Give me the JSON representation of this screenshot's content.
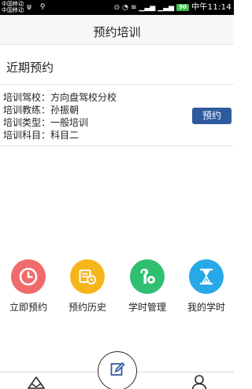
{
  "status_bar": {
    "carrier1": "中国移动",
    "carrier2": "中国移动",
    "battery": "90",
    "time": "中午11:14",
    "left_icons": "ψ ⚲"
  },
  "header": {
    "title": "预约培训"
  },
  "recent": {
    "title": "近期预约",
    "booking": {
      "school": "培训驾校：方向盘驾校分校",
      "coach": "培训教练：孙振朝",
      "type": "培训类型：一般培训",
      "subject": "培训科目：科目二",
      "button_label": "预约"
    }
  },
  "shortcuts": [
    {
      "label": "立即预约",
      "icon": "clock-icon",
      "color": "#f06b6b"
    },
    {
      "label": "预约历史",
      "icon": "history-icon",
      "color": "#f7b51c"
    },
    {
      "label": "学时管理",
      "icon": "wrench-icon",
      "color": "#2fbf71"
    },
    {
      "label": "我的学时",
      "icon": "hourglass-icon",
      "color": "#27a9e8"
    }
  ],
  "bottom_nav": {
    "left_icon": "triangle-icon",
    "center_icon": "edit-icon",
    "right_icon": "user-icon"
  },
  "colors": {
    "accent": "#2f5a9e"
  }
}
